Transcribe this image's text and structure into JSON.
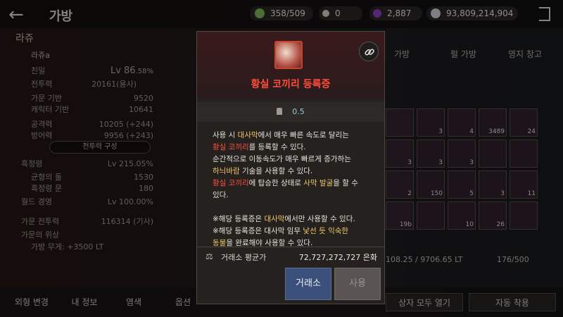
{
  "top": {
    "title": "가방",
    "currencies": [
      {
        "name": "energy",
        "value": "358/509",
        "color": "#7db35a"
      },
      {
        "name": "pearl",
        "value": "0",
        "color": "#d8c8c0"
      },
      {
        "name": "contribution",
        "value": "2,887",
        "color": "#8a3fb8"
      },
      {
        "name": "silver",
        "value": "93,809,214,904",
        "color": "#c9ccd4"
      }
    ]
  },
  "character": {
    "family_name": "라쥬",
    "char_name": "라쥬a",
    "intimacy_label": "친밀",
    "level": "Lv 86",
    "level_pct": ".58%",
    "combat_label": "전투력",
    "combat_value": "20161(용사)",
    "family_base_label": "가문 기반",
    "family_base_value": "9520",
    "char_base_label": "캐릭터 기반",
    "char_base_value": "10641",
    "attack_label": "공격력",
    "attack_value": "10205 (+244)",
    "defense_label": "방어력",
    "defense_value": "9956 (+243)",
    "combat_config_label": "전투력 구성",
    "black_spirit_label": "흑정령",
    "black_spirit_value": "Lv 215.05%",
    "balance_label": "균형의 돌",
    "balance_value": "1530",
    "black_gate_label": "흑정령 문",
    "black_gate_value": "180",
    "world_exp_label": "월드 경영",
    "world_exp_value": "Lv 100.00%",
    "family_power_label": "가문 전투력",
    "family_power_value": "116314 (기사)",
    "family_prestige_label": "가문의 위상",
    "family_weight": "가방 무게: +3500 LT"
  },
  "bottom": {
    "appearance": "외형 변경",
    "my_info": "내 정보",
    "dye": "염색",
    "options": "옵션",
    "open_all": "상자 모두 열기",
    "auto_equip": "자동 착용"
  },
  "inventory": {
    "tabs": [
      "가방",
      "펄 가방",
      "영지 창고"
    ],
    "weight": "108.25 / 9706.65 LT",
    "slots": "176/500",
    "counts": [
      "",
      "3",
      "4",
      "3489",
      "24",
      "3",
      "3",
      "3",
      "",
      "",
      "2",
      "150",
      "5",
      "3",
      "11",
      "19b",
      "",
      "10",
      "26",
      ""
    ]
  },
  "tooltip": {
    "item_name": "황실 코끼리 등록증",
    "weight": "0.5",
    "desc": {
      "l1a": "사용 시 ",
      "l1b": "대사막",
      "l1c": "에서 매우 빠른 속도로 달리는",
      "l2a": "황실 코끼리",
      "l2b": "를 등록할 수 있다.",
      "l3": "순간적으로 이동속도가 매우 빠르게 증가하는",
      "l4a": "하늬바람",
      "l4b": " 기술을 사용할 수 있다.",
      "l5a": "황실 코끼리",
      "l5b": "에 탑승한 상태로 ",
      "l5c": "사막 발굴",
      "l5d": "을 할 수",
      "l6": "있다.",
      "n1a": "※해당 등록증은 ",
      "n1b": "대사막",
      "n1c": "에서만 사용할 수 있다.",
      "n2a": "※해당 등록증은 대사막 임무 ",
      "n2b": "낯선 듯 익숙한",
      "n3a": "동물",
      "n3b": "을 완료해야 사용할 수 있다."
    },
    "price_label": "거래소 평균가",
    "price_value": "72,727,272,727 은화",
    "market_button": "거래소",
    "use_button": "사용"
  }
}
